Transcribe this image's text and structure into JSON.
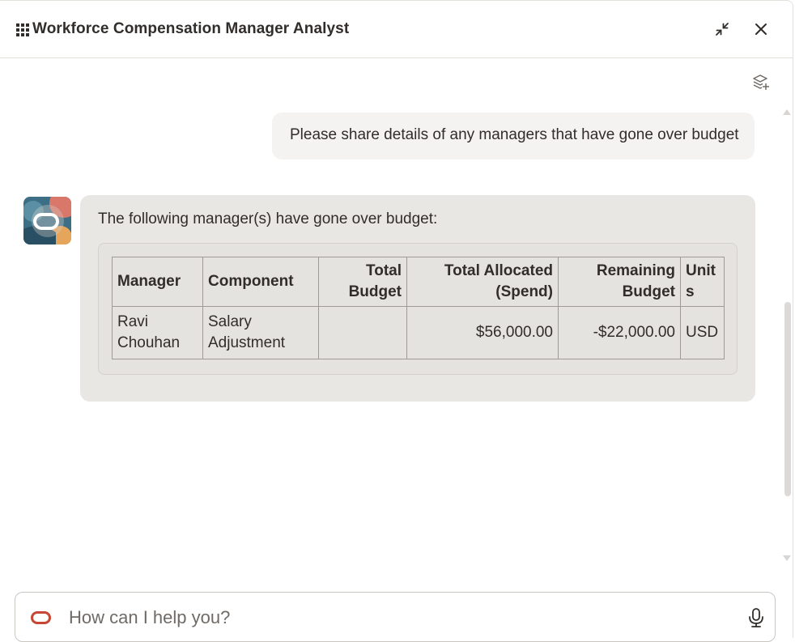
{
  "header": {
    "title": "Workforce Compensation Manager Analyst",
    "icons": {
      "apps": "app-grid-icon",
      "minimize": "minimize-arrows-icon",
      "close": "close-icon"
    }
  },
  "conversation": {
    "user_message": "Please share details of any managers that have gone over budget",
    "bot_intro": "The following manager(s) have gone over budget:",
    "table": {
      "headers": {
        "manager": "Manager",
        "component": "Component",
        "total_budget": "Total Budget",
        "total_allocated": "Total Allocated (Spend)",
        "remaining_budget": "Remaining Budget",
        "units": "Units"
      },
      "rows": [
        {
          "manager": "Ravi Chouhan",
          "component": "Salary Adjustment",
          "total_budget": "",
          "total_allocated": "$56,000.00",
          "remaining_budget": "-$22,000.00",
          "units": "USD"
        }
      ]
    }
  },
  "input": {
    "placeholder": "How can I help you?",
    "value": ""
  },
  "colors": {
    "oracle_red": "#c74634",
    "bubble_user": "#f4f3f1",
    "bubble_bot": "#e9e7e4",
    "text": "#312d2a"
  }
}
